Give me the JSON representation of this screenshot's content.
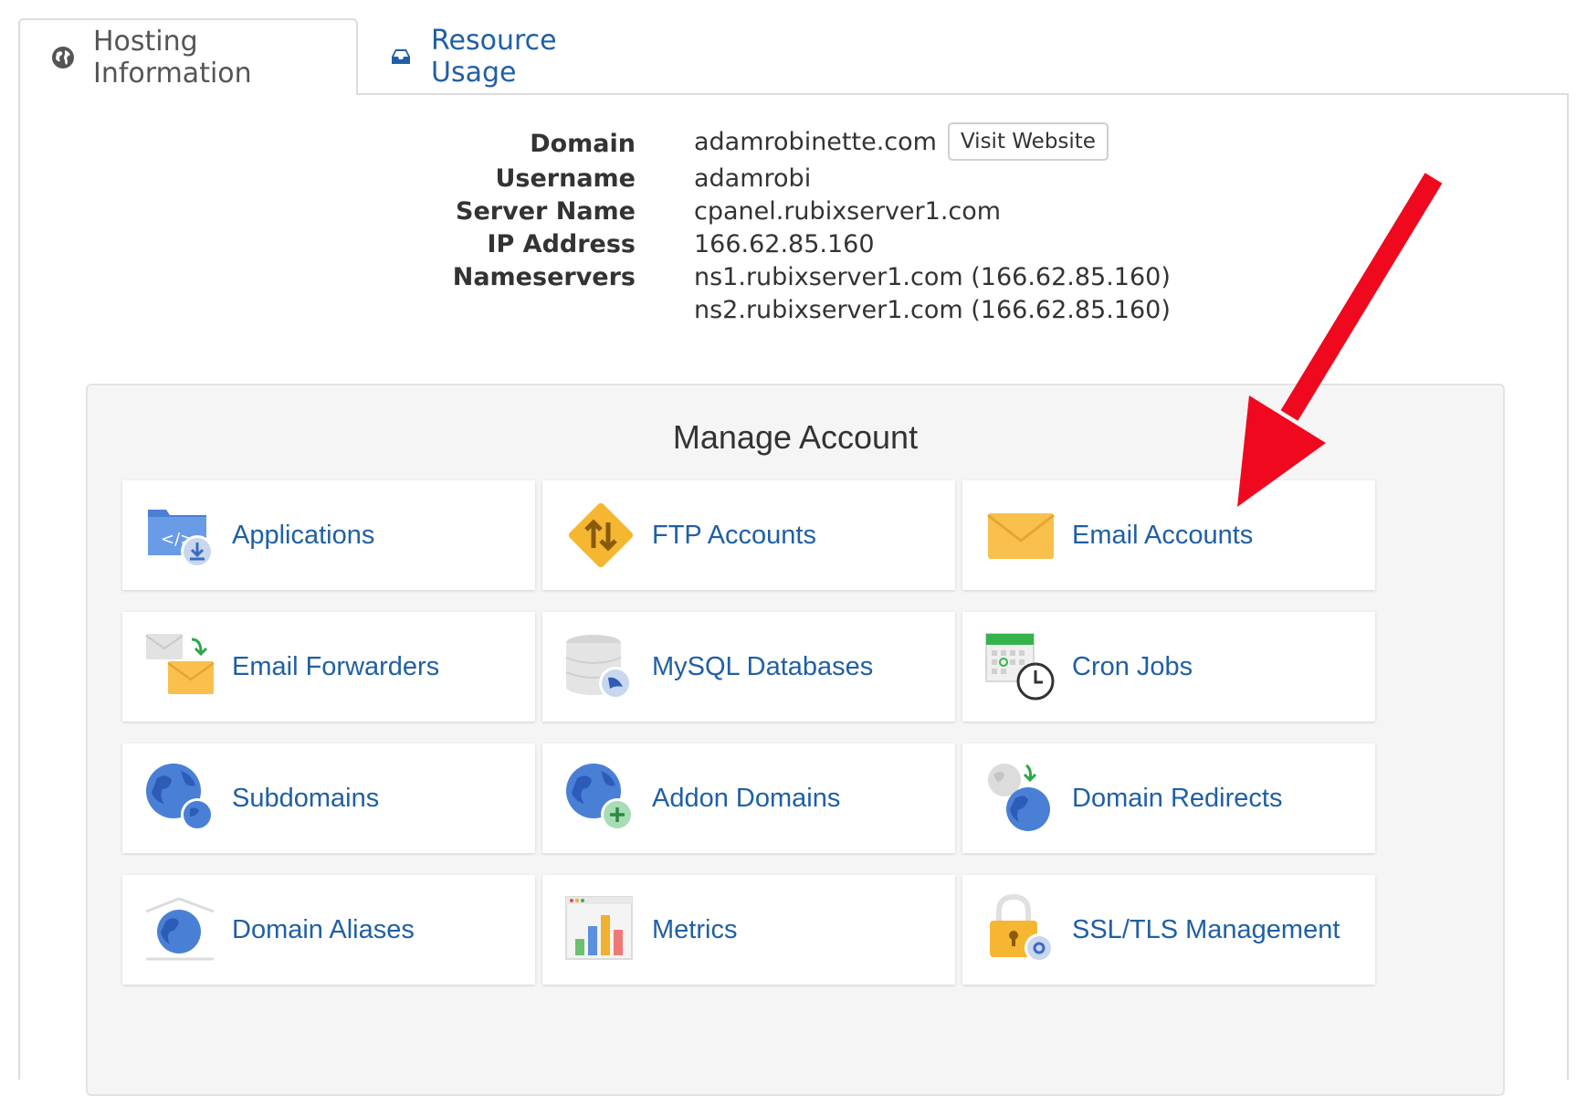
{
  "tabs": [
    {
      "label": "Hosting Information",
      "icon": "globe-icon",
      "active": true
    },
    {
      "label": "Resource Usage",
      "icon": "inbox-icon",
      "active": false
    }
  ],
  "hosting": {
    "domain_label": "Domain",
    "domain_value": "adamrobinette.com",
    "visit_label": "Visit Website",
    "username_label": "Username",
    "username_value": "adamrobi",
    "server_label": "Server Name",
    "server_value": "cpanel.rubixserver1.com",
    "ip_label": "IP Address",
    "ip_value": "166.62.85.160",
    "ns_label": "Nameservers",
    "ns1": "ns1.rubixserver1.com (166.62.85.160)",
    "ns2": "ns2.rubixserver1.com (166.62.85.160)"
  },
  "manage": {
    "title": "Manage Account",
    "items": [
      {
        "label": "Applications",
        "icon": "applications-icon"
      },
      {
        "label": "FTP Accounts",
        "icon": "ftp-icon"
      },
      {
        "label": "Email Accounts",
        "icon": "envelope-icon"
      },
      {
        "label": "Email Forwarders",
        "icon": "email-forward-icon"
      },
      {
        "label": "MySQL Databases",
        "icon": "database-icon"
      },
      {
        "label": "Cron Jobs",
        "icon": "calendar-clock-icon"
      },
      {
        "label": "Subdomains",
        "icon": "globe-pair-icon"
      },
      {
        "label": "Addon Domains",
        "icon": "globe-plus-icon"
      },
      {
        "label": "Domain Redirects",
        "icon": "globe-redirect-icon"
      },
      {
        "label": "Domain Aliases",
        "icon": "globe-alias-icon"
      },
      {
        "label": "Metrics",
        "icon": "bar-chart-icon"
      },
      {
        "label": "SSL/TLS Management",
        "icon": "padlock-icon"
      }
    ]
  },
  "annotation": {
    "color": "#f0081e",
    "icon": "red-arrow-icon"
  }
}
